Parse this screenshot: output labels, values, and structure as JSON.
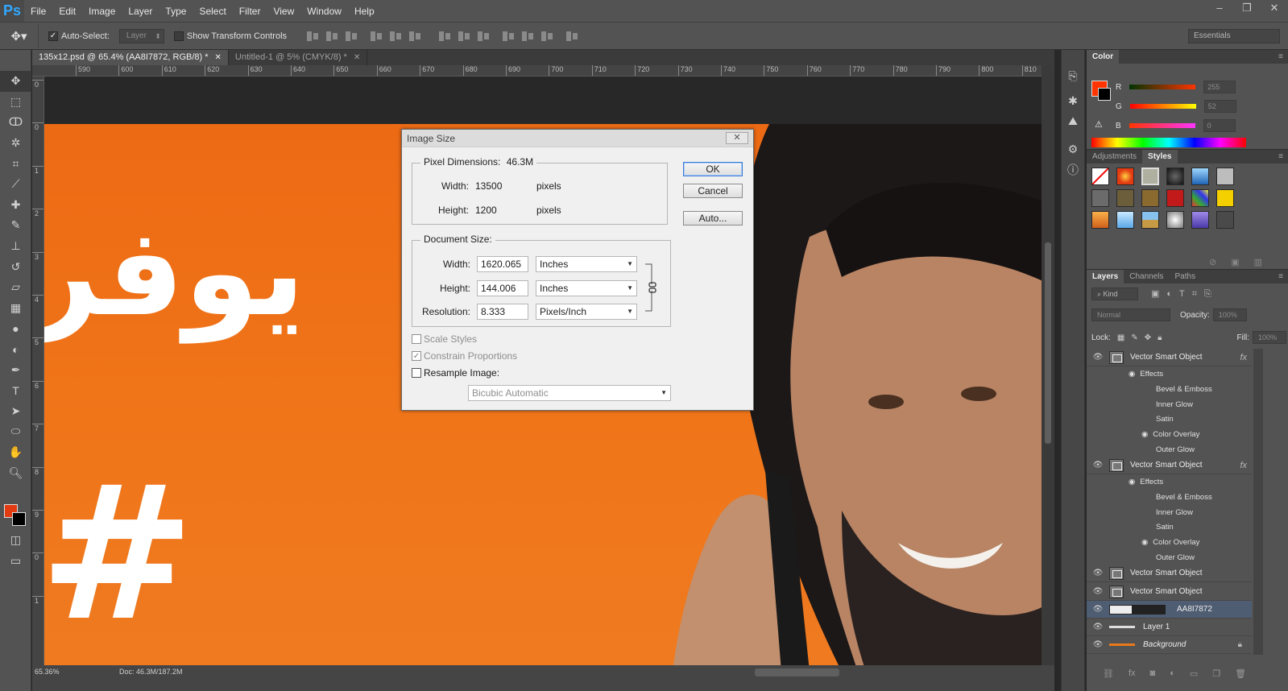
{
  "app": {
    "logo": "Ps"
  },
  "menu": [
    "File",
    "Edit",
    "Image",
    "Layer",
    "Type",
    "Select",
    "Filter",
    "View",
    "Window",
    "Help"
  ],
  "window_controls": [
    "–",
    "❐",
    "✕"
  ],
  "options": {
    "auto_select_label": "Auto-Select:",
    "auto_select_target": "Layer",
    "show_transform_label": "Show Transform Controls",
    "workspace": "Essentials"
  },
  "tabs": [
    {
      "label": "135x12.psd @ 65.4% (AA8I7872, RGB/8) *",
      "active": true
    },
    {
      "label": "Untitled-1 @ 5% (CMYK/8) *",
      "active": false
    }
  ],
  "ruler_h": [
    "590",
    "600",
    "610",
    "620",
    "630",
    "640",
    "650",
    "660",
    "670",
    "680",
    "690",
    "700",
    "710",
    "720",
    "730",
    "740",
    "750",
    "760",
    "770",
    "780",
    "790",
    "800",
    "810"
  ],
  "ruler_v": [
    "0",
    "0",
    "1",
    "2",
    "3",
    "4",
    "5",
    "6",
    "7",
    "8",
    "9",
    "0",
    "1"
  ],
  "canvas": {
    "arabic_text": "يوفر",
    "hash_text": "#",
    "background_color": "#ef6f18"
  },
  "status": {
    "zoom": "65.36%",
    "doc": "Doc: 46.3M/187.2M"
  },
  "dialog": {
    "title": "Image Size",
    "pixel_dimensions_label": "Pixel Dimensions:",
    "pixel_dimensions_value": "46.3M",
    "width_label": "Width:",
    "width_px": "13500",
    "height_label": "Height:",
    "height_px": "1200",
    "pixels_unit": "pixels",
    "document_size_label": "Document Size:",
    "doc_width": "1620.065",
    "doc_height": "144.006",
    "resolution_label": "Resolution:",
    "resolution": "8.333",
    "inches": "Inches",
    "pixels_per_inch": "Pixels/Inch",
    "scale_styles": "Scale Styles",
    "constrain_proportions": "Constrain Proportions",
    "resample_image": "Resample Image:",
    "resample_method": "Bicubic Automatic",
    "ok": "OK",
    "cancel": "Cancel",
    "auto": "Auto..."
  },
  "color_panel": {
    "tabs": [
      "Color"
    ],
    "r_label": "R",
    "r_value": "255",
    "g_label": "G",
    "g_value": "52",
    "b_label": "B",
    "b_value": "0",
    "fg_color": "#ff3400"
  },
  "styles_panel": {
    "tabs": [
      "Adjustments",
      "Styles"
    ]
  },
  "layers_panel": {
    "tabs": [
      "Layers",
      "Channels",
      "Paths"
    ],
    "kind_label": "Kind",
    "blend_mode": "Normal",
    "opacity_label": "Opacity:",
    "opacity_value": "100%",
    "lock_label": "Lock:",
    "fill_label": "Fill:",
    "fill_value": "100%",
    "layers": [
      {
        "name": "Vector Smart Object",
        "fx": "fx",
        "effects": [
          "Effects",
          "Bevel & Emboss",
          "Inner Glow",
          "Satin",
          "Color Overlay",
          "Outer Glow"
        ]
      },
      {
        "name": "Vector Smart Object",
        "fx": "fx",
        "effects": [
          "Effects",
          "Bevel & Emboss",
          "Inner Glow",
          "Satin",
          "Color Overlay",
          "Outer Glow"
        ]
      },
      {
        "name": "Vector Smart Object"
      },
      {
        "name": "Vector Smart Object"
      },
      {
        "name": "AA8I7872",
        "selected": true
      },
      {
        "name": "Layer 1"
      },
      {
        "name": "Background"
      }
    ]
  }
}
